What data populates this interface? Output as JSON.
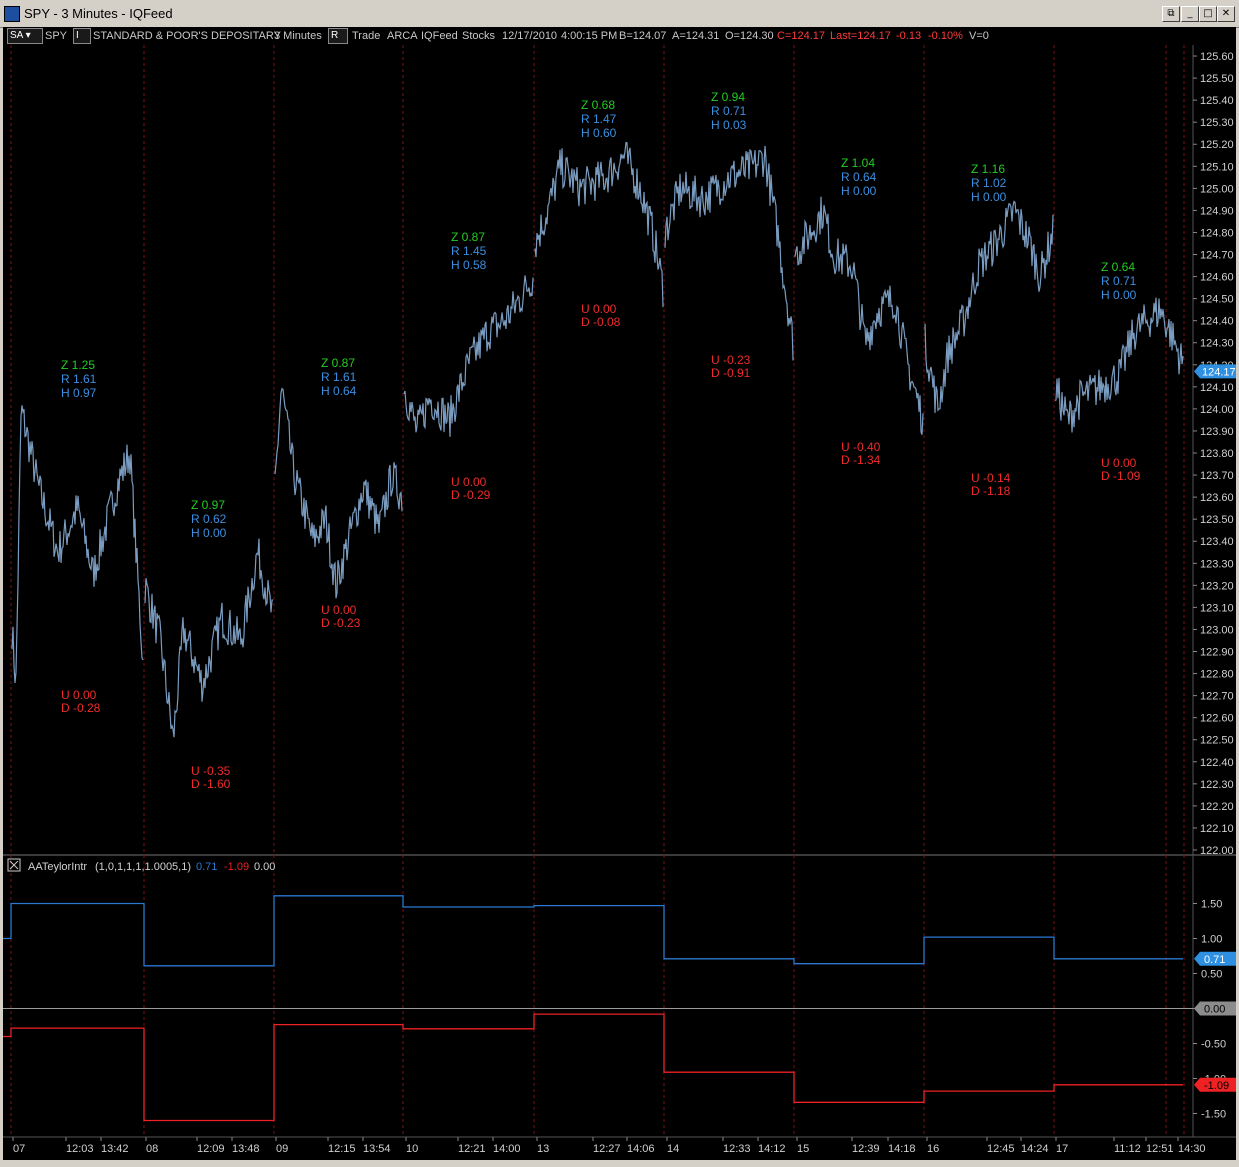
{
  "window": {
    "title": "SPY - 3 Minutes - IQFeed",
    "minimize": "_",
    "maximize": "□",
    "close": "✕"
  },
  "toolbar": {
    "symbol_btn": "SA",
    "symbol": "SPY",
    "i_btn": "I",
    "description": "STANDARD & POOR'S DEPOSITARY",
    "interval": "3 Minutes",
    "r_btn": "R",
    "data_type": "Trade",
    "exchange": "ARCA",
    "feed": "IQFeed",
    "category": "Stocks",
    "date": "12/17/2010",
    "time": "4:00:15 PM",
    "bid": "B=124.07",
    "ask": "A=124.31",
    "open": "O=124.30",
    "close": "C=124.17",
    "last": "Last=124.17",
    "change": "-0.13",
    "change_pct": "-0.10%",
    "volume": "V=0"
  },
  "colors": {
    "price_line": "#7a9cc0",
    "green_label": "#22cc22",
    "blue_label": "#3a8fe0",
    "red_label": "#ee2a2a",
    "session_divider": "#7a1010",
    "indicator_blue": "#2a78d0",
    "indicator_red": "#ee2222"
  },
  "price_axis": {
    "ticks": [
      "125.60",
      "125.50",
      "125.40",
      "125.30",
      "125.20",
      "125.10",
      "125.00",
      "124.90",
      "124.80",
      "124.70",
      "124.60",
      "124.50",
      "124.40",
      "124.30",
      "124.20",
      "124.10",
      "124.00",
      "123.90",
      "123.80",
      "123.70",
      "123.60",
      "123.50",
      "123.40",
      "123.30",
      "123.20",
      "123.10",
      "123.00",
      "122.90",
      "122.80",
      "122.70",
      "122.60",
      "122.50",
      "122.40",
      "122.30",
      "122.20",
      "122.10",
      "122.00"
    ],
    "last_price_marker": "124.17"
  },
  "indicator": {
    "name": "AATeylorIntr",
    "params": "(1,0,1,1,1,1.0005,1)",
    "value_blue": "0.71",
    "value_red": "-1.09",
    "value_zero": "0.00",
    "axis_ticks": [
      "1.50",
      "1.00",
      "0.50",
      "0.00",
      "-0.50",
      "-1.00",
      "-1.50"
    ],
    "blue_marker": "0.71",
    "zero_marker": "0.00",
    "red_marker": "-1.09"
  },
  "time_axis": {
    "labels": [
      "07",
      "12:03",
      "13:42",
      "08",
      "12:09",
      "13:48",
      "09",
      "12:15",
      "13:54",
      "10",
      "12:21",
      "14:00",
      "13",
      "12:27",
      "14:06",
      "14",
      "12:33",
      "14:12",
      "15",
      "12:39",
      "14:18",
      "16",
      "12:45",
      "14:24",
      "17",
      "11:12",
      "12:51",
      "14:30"
    ]
  },
  "annotations": [
    {
      "top": [
        "Z 1.25",
        "R 1.61",
        "H 0.97"
      ],
      "bottom": [
        "U 0.00",
        "D -0.28"
      ]
    },
    {
      "top": [
        "Z 0.97",
        "R 0.62",
        "H 0.00"
      ],
      "bottom": [
        "U -0.35",
        "D -1.60"
      ]
    },
    {
      "top": [
        "Z 0.87",
        "R 1.61",
        "H 0.64"
      ],
      "bottom": [
        "U 0.00",
        "D -0.23"
      ]
    },
    {
      "top": [
        "Z 0.87",
        "R 1.45",
        "H 0.58"
      ],
      "bottom": [
        "U 0.00",
        "D -0.29"
      ]
    },
    {
      "top": [
        "Z 0.68",
        "R 1.47",
        "H 0.60"
      ],
      "bottom": [
        "U 0.00",
        "D -0.08"
      ]
    },
    {
      "top": [
        "Z 0.94",
        "R 0.71",
        "H 0.03"
      ],
      "bottom": [
        "U -0.23",
        "D -0.91"
      ]
    },
    {
      "top": [
        "Z 1.04",
        "R 0.64",
        "H 0.00"
      ],
      "bottom": [
        "U -0.40",
        "D -1.34"
      ]
    },
    {
      "top": [
        "Z 1.16",
        "R 1.02",
        "H 0.00"
      ],
      "bottom": [
        "U -0.14",
        "D -1.18"
      ]
    },
    {
      "top": [
        "Z 0.64",
        "R 0.71",
        "H 0.00"
      ],
      "bottom": [
        "U 0.00",
        "D -1.09"
      ]
    }
  ],
  "chart_data": {
    "type": "line",
    "title": "SPY - 3 Minutes - IQFeed",
    "ylim": [
      122.0,
      125.65
    ],
    "session_days": [
      "07",
      "08",
      "09",
      "10",
      "13",
      "14",
      "15",
      "16",
      "17"
    ],
    "price_keypoints": [
      [
        [
          0,
          123.0
        ],
        [
          0.03,
          122.75
        ],
        [
          0.07,
          124.0
        ],
        [
          0.2,
          123.65
        ],
        [
          0.35,
          123.35
        ],
        [
          0.5,
          123.55
        ],
        [
          0.62,
          123.25
        ],
        [
          0.8,
          123.65
        ],
        [
          0.9,
          123.8
        ],
        [
          1,
          122.85
        ]
      ],
      [
        [
          0,
          123.2
        ],
        [
          0.12,
          122.95
        ],
        [
          0.22,
          122.5
        ],
        [
          0.3,
          123.0
        ],
        [
          0.45,
          122.75
        ],
        [
          0.6,
          123.05
        ],
        [
          0.75,
          122.95
        ],
        [
          0.88,
          123.35
        ],
        [
          1,
          123.05
        ]
      ],
      [
        [
          0,
          123.65
        ],
        [
          0.05,
          124.1
        ],
        [
          0.15,
          123.7
        ],
        [
          0.3,
          123.4
        ],
        [
          0.4,
          123.5
        ],
        [
          0.48,
          123.2
        ],
        [
          0.6,
          123.45
        ],
        [
          0.7,
          123.65
        ],
        [
          0.82,
          123.45
        ],
        [
          0.92,
          123.7
        ],
        [
          1,
          123.6
        ]
      ],
      [
        [
          0,
          124.1
        ],
        [
          0.1,
          123.9
        ],
        [
          0.2,
          124.05
        ],
        [
          0.35,
          123.95
        ],
        [
          0.5,
          124.2
        ],
        [
          0.65,
          124.35
        ],
        [
          0.78,
          124.4
        ],
        [
          0.9,
          124.5
        ],
        [
          1,
          124.6
        ]
      ],
      [
        [
          0,
          124.75
        ],
        [
          0.1,
          124.9
        ],
        [
          0.2,
          125.1
        ],
        [
          0.35,
          125.0
        ],
        [
          0.55,
          125.05
        ],
        [
          0.7,
          125.15
        ],
        [
          0.82,
          125.0
        ],
        [
          0.92,
          124.8
        ],
        [
          1,
          124.55
        ]
      ],
      [
        [
          0,
          124.8
        ],
        [
          0.12,
          125.0
        ],
        [
          0.3,
          124.95
        ],
        [
          0.5,
          125.05
        ],
        [
          0.7,
          125.1
        ],
        [
          0.78,
          125.15
        ],
        [
          0.88,
          124.8
        ],
        [
          1,
          124.3
        ]
      ],
      [
        [
          0,
          124.7
        ],
        [
          0.12,
          124.8
        ],
        [
          0.22,
          124.9
        ],
        [
          0.3,
          124.7
        ],
        [
          0.45,
          124.65
        ],
        [
          0.55,
          124.3
        ],
        [
          0.65,
          124.45
        ],
        [
          0.78,
          124.5
        ],
        [
          0.88,
          124.2
        ],
        [
          1,
          123.95
        ]
      ],
      [
        [
          0,
          124.3
        ],
        [
          0.1,
          124.0
        ],
        [
          0.18,
          124.25
        ],
        [
          0.3,
          124.4
        ],
        [
          0.42,
          124.65
        ],
        [
          0.55,
          124.75
        ],
        [
          0.7,
          124.9
        ],
        [
          0.82,
          124.75
        ],
        [
          0.9,
          124.6
        ],
        [
          1,
          124.8
        ]
      ],
      [
        [
          0,
          124.1
        ],
        [
          0.1,
          123.95
        ],
        [
          0.2,
          124.05
        ],
        [
          0.35,
          124.1
        ],
        [
          0.5,
          124.15
        ],
        [
          0.62,
          124.35
        ],
        [
          0.72,
          124.4
        ],
        [
          0.82,
          124.45
        ],
        [
          0.9,
          124.35
        ],
        [
          1,
          124.2
        ]
      ]
    ],
    "indicator_series": [
      {
        "name": "blue",
        "values": [
          1.5,
          0.61,
          1.61,
          1.45,
          1.47,
          0.71,
          0.64,
          1.02,
          0.71
        ]
      },
      {
        "name": "red",
        "values": [
          -0.28,
          -1.6,
          -0.23,
          -0.29,
          -0.08,
          -0.91,
          -1.34,
          -1.18,
          -1.09
        ]
      }
    ],
    "indicator_ylim": [
      -1.75,
      1.95
    ]
  }
}
